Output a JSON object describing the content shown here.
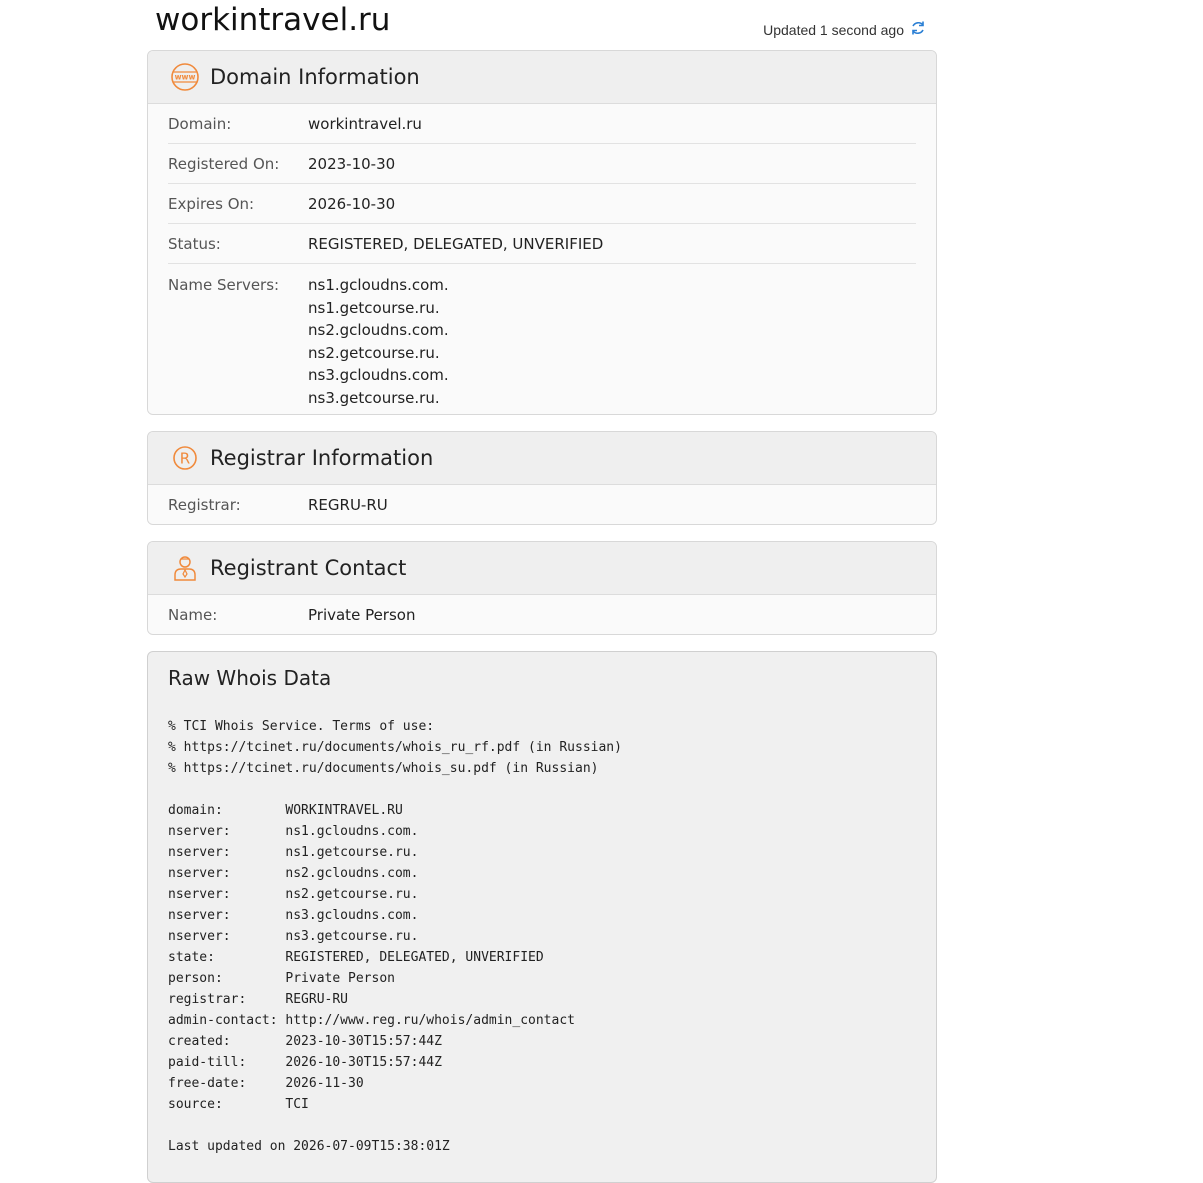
{
  "header": {
    "title": "workintravel.ru",
    "updated": "Updated 1 second ago"
  },
  "domain_info": {
    "title": "Domain Information",
    "rows": [
      {
        "label": "Domain:",
        "value": "workintravel.ru"
      },
      {
        "label": "Registered On:",
        "value": "2023-10-30"
      },
      {
        "label": "Expires On:",
        "value": "2026-10-30"
      },
      {
        "label": "Status:",
        "value": "REGISTERED, DELEGATED, UNVERIFIED"
      }
    ],
    "name_servers_label": "Name Servers:",
    "name_servers": [
      "ns1.gcloudns.com.",
      "ns1.getcourse.ru.",
      "ns2.gcloudns.com.",
      "ns2.getcourse.ru.",
      "ns3.gcloudns.com.",
      "ns3.getcourse.ru."
    ]
  },
  "registrar_info": {
    "title": "Registrar Information",
    "label": "Registrar:",
    "value": "REGRU-RU"
  },
  "registrant_contact": {
    "title": "Registrant Contact",
    "label": "Name:",
    "value": "Private Person"
  },
  "raw_whois": {
    "title": "Raw Whois Data",
    "text": "% TCI Whois Service. Terms of use:\n% https://tcinet.ru/documents/whois_ru_rf.pdf (in Russian)\n% https://tcinet.ru/documents/whois_su.pdf (in Russian)\n\ndomain:        WORKINTRAVEL.RU\nnserver:       ns1.gcloudns.com.\nnserver:       ns1.getcourse.ru.\nnserver:       ns2.gcloudns.com.\nnserver:       ns2.getcourse.ru.\nnserver:       ns3.gcloudns.com.\nnserver:       ns3.getcourse.ru.\nstate:         REGISTERED, DELEGATED, UNVERIFIED\nperson:        Private Person\nregistrar:     REGRU-RU\nadmin-contact: http://www.reg.ru/whois/admin_contact\ncreated:       2023-10-30T15:57:44Z\npaid-till:     2026-10-30T15:57:44Z\nfree-date:     2026-11-30\nsource:        TCI\n\nLast updated on 2026-07-09T15:38:01Z"
  },
  "colors": {
    "accent": "#f08a3c",
    "refresh": "#2a7fd4"
  },
  "icons": {
    "domain": "www-globe-icon",
    "registrar": "registered-icon",
    "registrant": "person-icon",
    "refresh": "refresh-icon"
  }
}
